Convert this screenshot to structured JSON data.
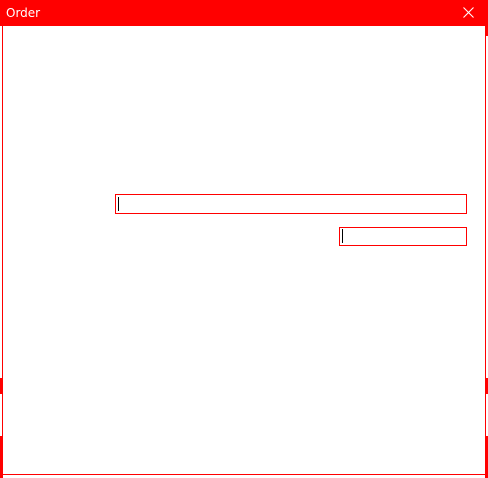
{
  "window": {
    "title": "Order"
  },
  "controls": {
    "close_icon": "close-icon"
  },
  "fields": [
    {
      "value": "",
      "placeholder": ""
    },
    {
      "value": "",
      "placeholder": ""
    }
  ],
  "colors": {
    "accent": "#ff0000",
    "background": "#ffffff",
    "title_text": "#ffffff"
  }
}
